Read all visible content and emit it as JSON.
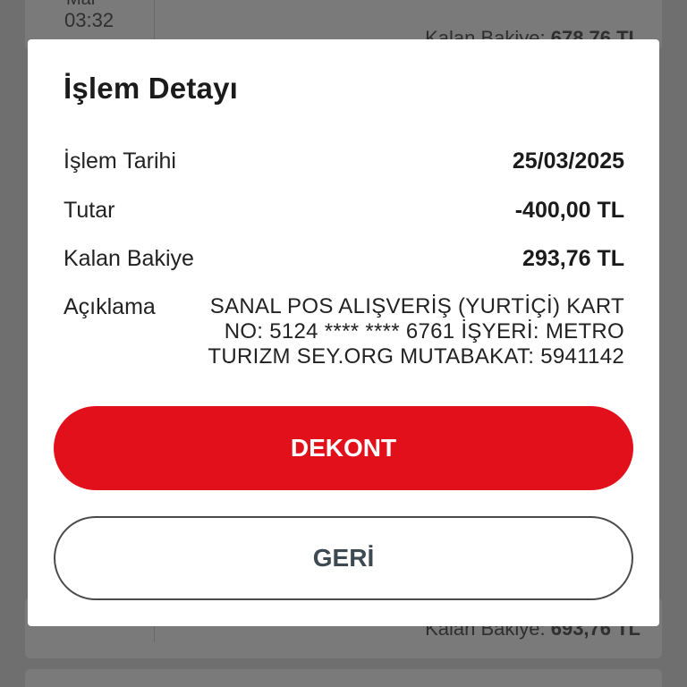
{
  "background": {
    "top_item": {
      "month": "Mar",
      "time": "03:32",
      "balance_label": "Kalan Bakiye:",
      "balance_value": "678,76 TL"
    },
    "bottom_item": {
      "balance_label": "Kalan Bakiye:",
      "balance_value": "693,76 TL"
    }
  },
  "dialog": {
    "title": "İşlem Detayı",
    "rows": [
      {
        "label": "İşlem Tarihi",
        "value": "25/03/2025"
      },
      {
        "label": "Tutar",
        "value": "-400,00 TL"
      },
      {
        "label": "Kalan Bakiye",
        "value": "293,76 TL"
      },
      {
        "label": "Açıklama",
        "value": "SANAL POS ALIŞVERİŞ (YURTİÇİ) KART NO: 5124 **** **** 6761 İŞYERİ: METRO TURIZM SEY.ORG MUTABAKAT: 5941142"
      }
    ],
    "primary_button": "DEKONT",
    "secondary_button": "GERİ"
  },
  "colors": {
    "accent": "#e2101b",
    "overlay": "#6f6f6f",
    "secondary_text": "#3d4a52"
  }
}
